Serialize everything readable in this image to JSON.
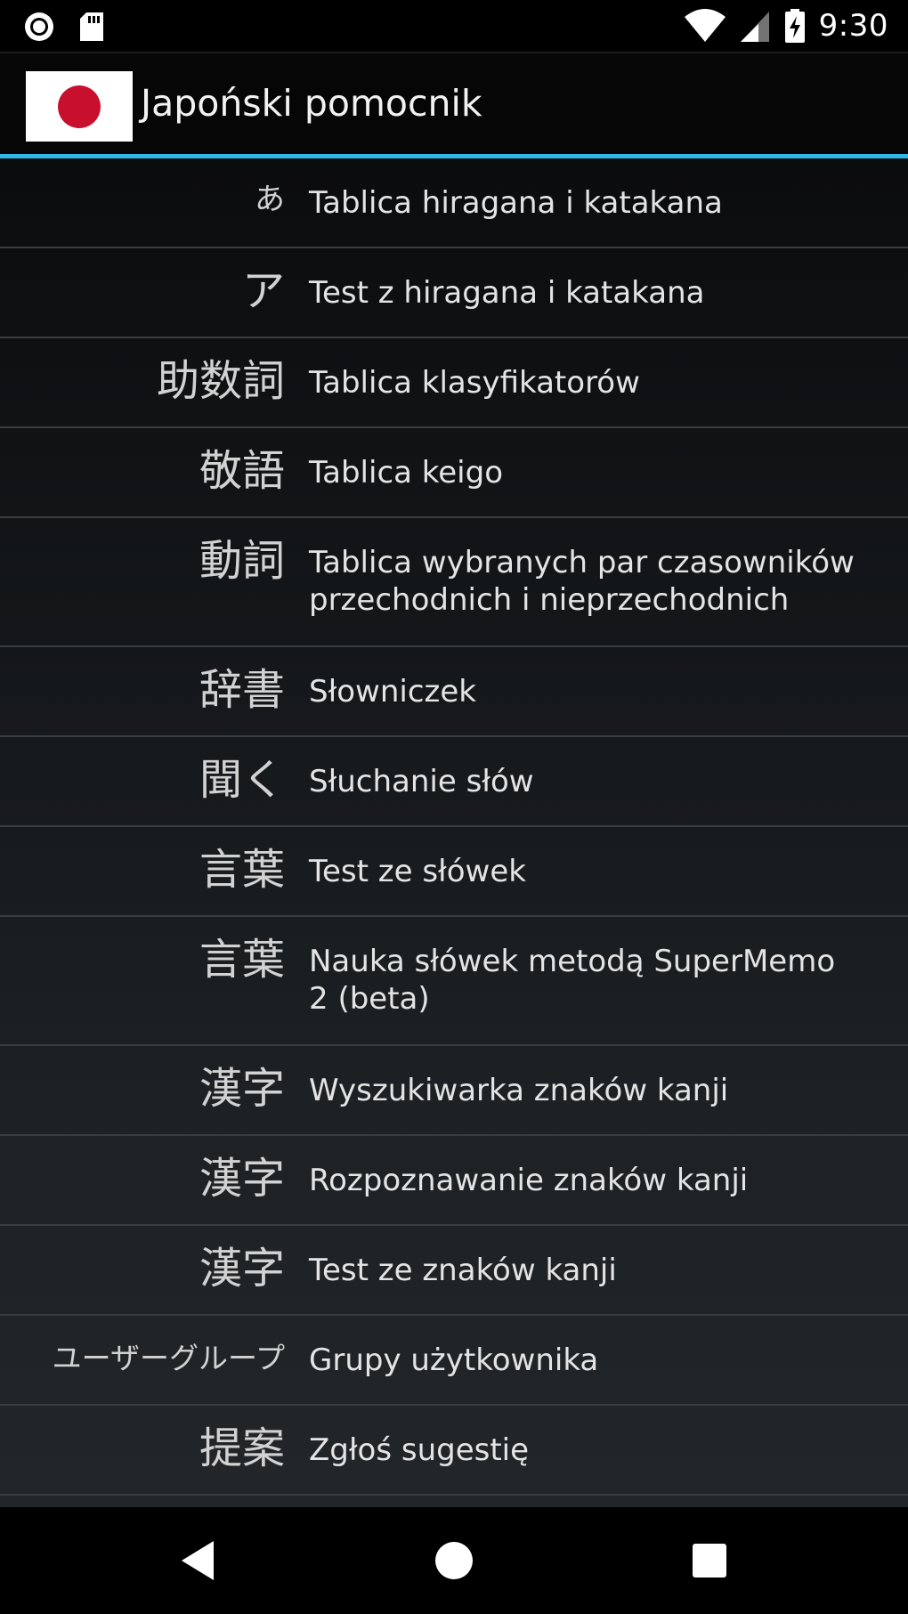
{
  "status_bar": {
    "time": "9:30",
    "left_icons": [
      "record-icon",
      "sd-card-icon"
    ],
    "right_icons": [
      "wifi-icon",
      "cell-signal-icon",
      "battery-charging-icon"
    ]
  },
  "action_bar": {
    "title": "Japoński pomocnik",
    "accent_color": "#33b5e5",
    "logo": "japan-flag-icon"
  },
  "menu": [
    {
      "jp": "あ",
      "label": "Tablica hiragana i katakana"
    },
    {
      "jp": "ア",
      "label": "Test z hiragana i katakana"
    },
    {
      "jp": "助数詞",
      "label": "Tablica klasyfikatorów"
    },
    {
      "jp": "敬語",
      "label": "Tablica keigo"
    },
    {
      "jp": "動詞",
      "label": "Tablica wybranych par czasowników przechodnich i nieprzechodnich"
    },
    {
      "jp": "辞書",
      "label": "Słowniczek"
    },
    {
      "jp": "聞く",
      "label": "Słuchanie słów"
    },
    {
      "jp": "言葉",
      "label": "Test ze słówek"
    },
    {
      "jp": "言葉",
      "label": "Nauka słówek metodą SuperMemo 2 (beta)"
    },
    {
      "jp": "漢字",
      "label": "Wyszukiwarka znaków kanji"
    },
    {
      "jp": "漢字",
      "label": "Rozpoznawanie znaków kanji"
    },
    {
      "jp": "漢字",
      "label": "Test ze znaków kanji"
    },
    {
      "jp": "ユーザーグループ",
      "label": "Grupy użytkownika"
    },
    {
      "jp": "提案",
      "label": "Zgłoś sugestię"
    }
  ],
  "nav_bar": {
    "buttons": [
      "back-icon",
      "home-icon",
      "recents-icon"
    ]
  }
}
